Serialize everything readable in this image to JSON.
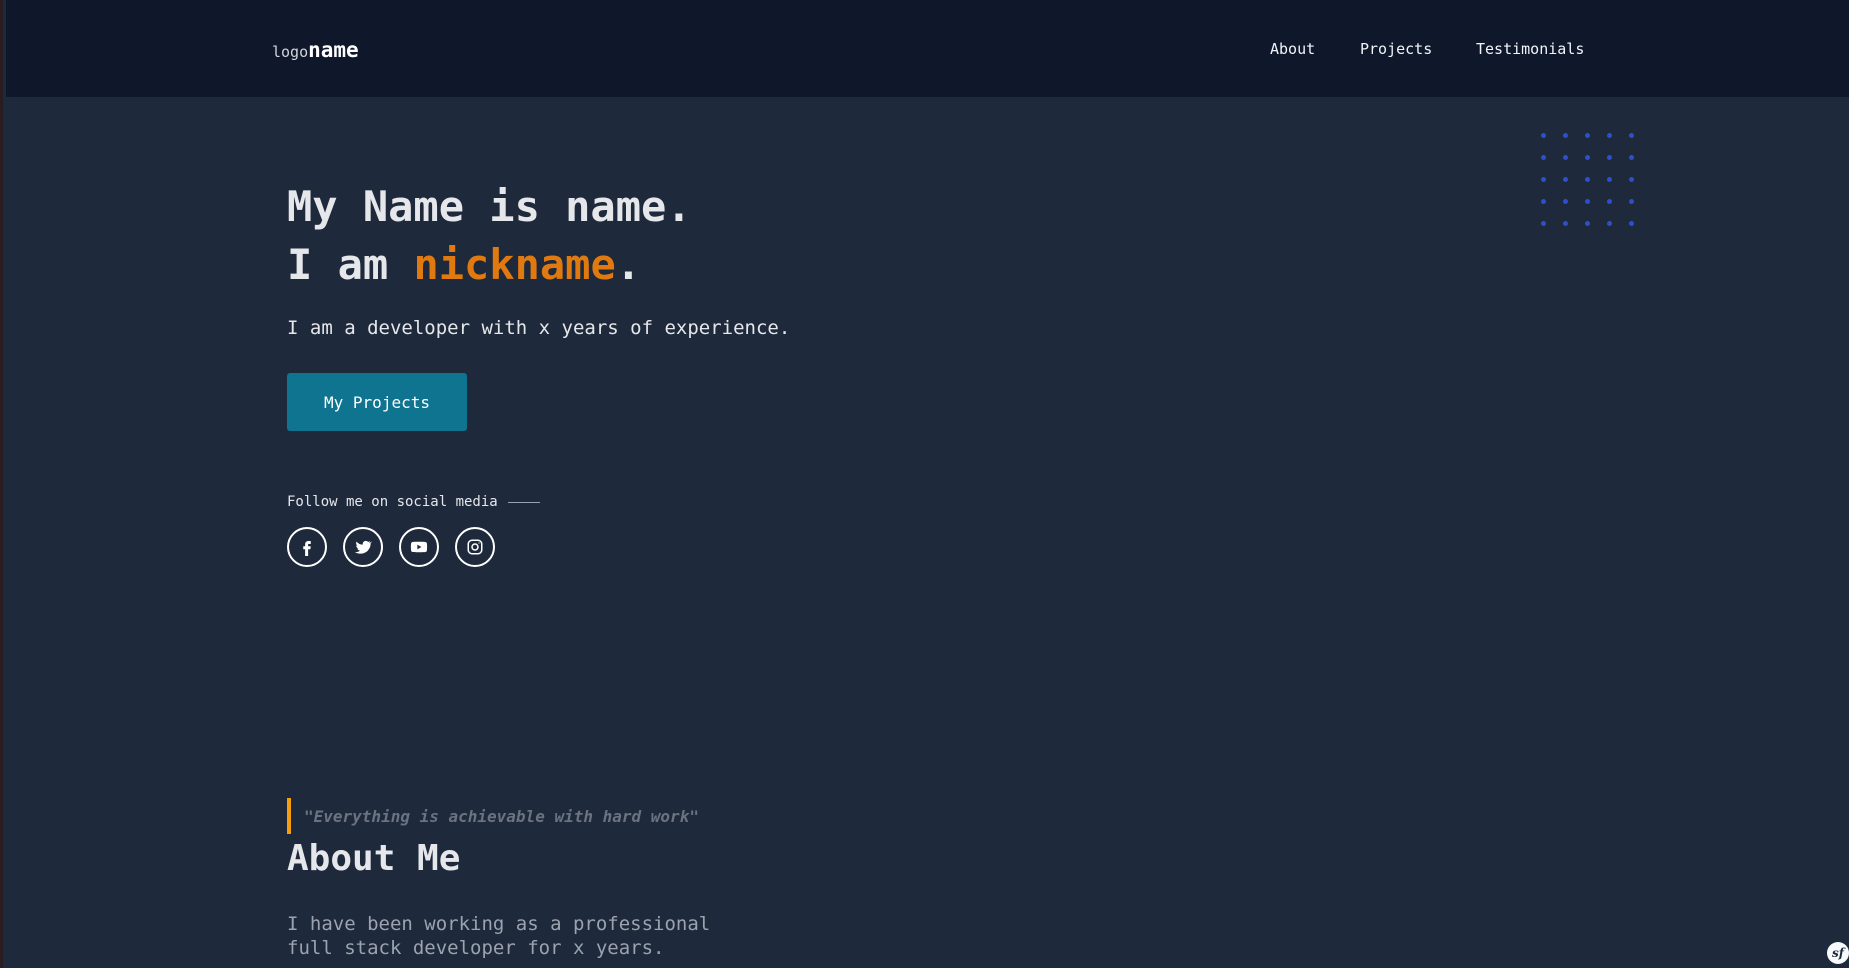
{
  "header": {
    "logo_prefix": "logo",
    "logo_name": "name",
    "nav": [
      {
        "label": "About"
      },
      {
        "label": "Projects"
      },
      {
        "label": "Testimonials"
      }
    ]
  },
  "hero": {
    "line1": "My Name is name.",
    "line2_prefix": "I am ",
    "line2_accent": "nickname",
    "line2_suffix": ".",
    "subtitle": "I am a developer with x years of experience.",
    "cta_label": "My Projects",
    "follow_label": "Follow me on social media",
    "socials": [
      {
        "icon": "facebook-icon"
      },
      {
        "icon": "twitter-icon"
      },
      {
        "icon": "youtube-icon"
      },
      {
        "icon": "instagram-icon"
      }
    ]
  },
  "about": {
    "quote": "\"Everything is achievable with hard work\"",
    "title": "About Me",
    "text": "I have been working as a professional full stack developer for x years."
  },
  "badge": {
    "glyph": "sf"
  },
  "colors": {
    "accent": "#e07a10",
    "button": "#0e7490",
    "quote_bar": "#f59e0b",
    "dots": "#2b4fd1"
  }
}
